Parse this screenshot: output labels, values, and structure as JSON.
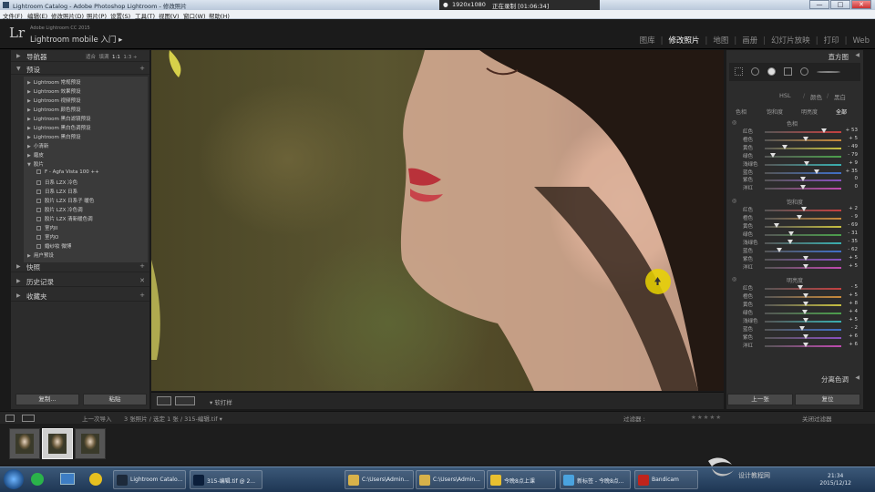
{
  "window": {
    "title": "Lightroom Catalog - Adobe Photoshop Lightroom - 修改照片",
    "recorder": {
      "resolution": "1920x1080",
      "status": "正在录制 [01:06:34]"
    },
    "buttons": [
      "—",
      "□",
      "✕"
    ]
  },
  "menu": [
    "文件(F)",
    "编辑(E)",
    "修改照片(D)",
    "照片(P)",
    "设置(S)",
    "工具(T)",
    "视图(V)",
    "窗口(W)",
    "帮助(H)"
  ],
  "identity": {
    "logo": "Lr",
    "version": "Adobe Lightroom CC 2015",
    "mobile": "Lightroom mobile 入门 ▸"
  },
  "modules": [
    "图库",
    "修改照片",
    "地图",
    "画册",
    "幻灯片放映",
    "打印",
    "Web"
  ],
  "left_panel": {
    "navigator": {
      "label": "导航器",
      "options": [
        "适合",
        "填满",
        "1:1",
        "1:3 ÷"
      ]
    },
    "presets_label": "预设",
    "presets": [
      {
        "label": "Lightroom 常规预设",
        "kind": "folder"
      },
      {
        "label": "Lightroom 效果预设",
        "kind": "folder"
      },
      {
        "label": "Lightroom 视频预设",
        "kind": "folder"
      },
      {
        "label": "Lightroom 颜色预设",
        "kind": "folder"
      },
      {
        "label": "Lightroom 黑白滤镜预设",
        "kind": "folder"
      },
      {
        "label": "Lightroom 黑白色调预设",
        "kind": "folder"
      },
      {
        "label": "Lightroom 黑白预设",
        "kind": "folder"
      },
      {
        "label": "小清新",
        "kind": "folder"
      },
      {
        "label": "磨皮",
        "kind": "folder"
      },
      {
        "label": "胶片",
        "kind": "open"
      },
      {
        "label": "F - Agfa Vista 100 ++",
        "kind": "preset"
      },
      {
        "label": "日系 LZX 冷色",
        "kind": "preset"
      },
      {
        "label": "日系 LZX 日系",
        "kind": "preset"
      },
      {
        "label": "胶片 LZX 日系子 暖色",
        "kind": "preset"
      },
      {
        "label": "胶片 LZX 冷色调",
        "kind": "preset"
      },
      {
        "label": "胶片 LZX 清新暖色调",
        "kind": "preset"
      },
      {
        "label": "室内II",
        "kind": "preset"
      },
      {
        "label": "室内O",
        "kind": "preset"
      },
      {
        "label": "婚纱妆 微博",
        "kind": "preset"
      },
      {
        "label": "用户预设",
        "kind": "folder"
      }
    ],
    "snapshots": "快照",
    "history": "历史记录",
    "collections": "收藏夹",
    "copy_button": "复制...",
    "paste_button": "粘贴"
  },
  "toolbar": {
    "sort_label": "▾ 软打样"
  },
  "right_panel": {
    "histogram_label": "直方图",
    "hsl_header": "HSL / 颜色 / 黑白",
    "hsl_title": "HSL",
    "color_tab": "颜色",
    "bw_tab": "黑白",
    "tabs": [
      "色相",
      "饱和度",
      "明亮度",
      "全部"
    ],
    "sections": [
      {
        "title": "色相",
        "sliders": [
          {
            "name": "红色",
            "value": "+ 53",
            "pos": 0.77
          },
          {
            "name": "橙色",
            "value": "+ 5",
            "pos": 0.53
          },
          {
            "name": "黄色",
            "value": "- 49",
            "pos": 0.26
          },
          {
            "name": "绿色",
            "value": "- 79",
            "pos": 0.11
          },
          {
            "name": "浅绿色",
            "value": "+ 9",
            "pos": 0.55
          },
          {
            "name": "蓝色",
            "value": "+ 35",
            "pos": 0.68
          },
          {
            "name": "紫色",
            "value": "0",
            "pos": 0.5
          },
          {
            "name": "洋红",
            "value": "0",
            "pos": 0.5
          }
        ]
      },
      {
        "title": "饱和度",
        "sliders": [
          {
            "name": "红色",
            "value": "+ 2",
            "pos": 0.51
          },
          {
            "name": "橙色",
            "value": "- 9",
            "pos": 0.45
          },
          {
            "name": "黄色",
            "value": "- 69",
            "pos": 0.16
          },
          {
            "name": "绿色",
            "value": "- 31",
            "pos": 0.35
          },
          {
            "name": "浅绿色",
            "value": "- 35",
            "pos": 0.33
          },
          {
            "name": "蓝色",
            "value": "- 62",
            "pos": 0.19
          },
          {
            "name": "紫色",
            "value": "+ 5",
            "pos": 0.53
          },
          {
            "name": "洋红",
            "value": "+ 5",
            "pos": 0.53
          }
        ]
      },
      {
        "title": "明亮度",
        "sliders": [
          {
            "name": "红色",
            "value": "- 5",
            "pos": 0.47
          },
          {
            "name": "橙色",
            "value": "+ 5",
            "pos": 0.53
          },
          {
            "name": "黄色",
            "value": "+ 8",
            "pos": 0.54
          },
          {
            "name": "绿色",
            "value": "+ 4",
            "pos": 0.52
          },
          {
            "name": "浅绿色",
            "value": "+ 5",
            "pos": 0.53
          },
          {
            "name": "蓝色",
            "value": "- 2",
            "pos": 0.49
          },
          {
            "name": "紫色",
            "value": "+ 6",
            "pos": 0.53
          },
          {
            "name": "洋红",
            "value": "+ 6",
            "pos": 0.53
          }
        ]
      }
    ],
    "split_toning": "分离色调",
    "prev_button": "上一张",
    "reset_button": "复位"
  },
  "filmbar": {
    "source": "上一次导入",
    "info": "3 张照片 / 选定 1 张 / 315-编辑.tif ▾",
    "filter_label": "过滤器 :",
    "filter_value": "关闭过滤器"
  },
  "taskbar": {
    "tasks": [
      {
        "label": "Lightroom Catalo...",
        "color": "#1d2a3b"
      },
      {
        "label": "315-编辑.tif @ 2...",
        "color": "#0b1e3a"
      },
      {
        "label": "C:\\Users\\Admin...",
        "color": "#d8b24a"
      },
      {
        "label": "C:\\Users\\Admin...",
        "color": "#d8b24a"
      },
      {
        "label": "今晚8点上课",
        "color": "#e8c030"
      },
      {
        "label": "新标签 - 今晚8点...",
        "color": "#4aa3df"
      },
      {
        "label": "Bandicam",
        "color": "#c0241c"
      }
    ],
    "time": "21:34",
    "date": "2015/12/12"
  },
  "watermark": "设计教程网"
}
